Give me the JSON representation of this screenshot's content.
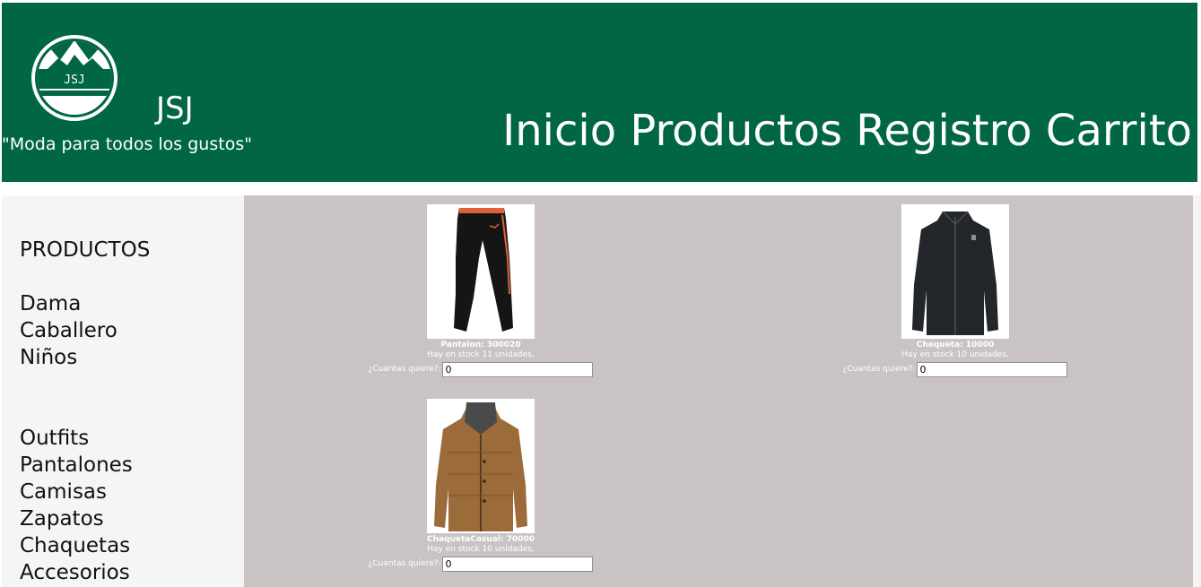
{
  "header": {
    "brand": "JSJ",
    "logo_text": "JSJ",
    "slogan": "\"Moda para todos los gustos\"",
    "nav": [
      "Inicio",
      "Productos",
      "Registro",
      "Carrito"
    ],
    "colors": {
      "header_bg": "#006643",
      "content_bg": "#c9c4c3",
      "sidebar_bg": "#f5f5f5"
    }
  },
  "sidebar": {
    "heading": "PRODUCTOS",
    "categories": [
      "Dama",
      "Caballero",
      "Niños"
    ],
    "types": [
      "Outfits",
      "Pantalones",
      "Camisas",
      "Zapatos",
      "Chaquetas",
      "Accesorios"
    ]
  },
  "products": [
    {
      "title": "Pantalon: 300020",
      "stock": "Hay en stock 11 unidades,",
      "qty_label": "¿Cuantas quiere?:",
      "qty_value": "0",
      "image": "pants-image"
    },
    {
      "title": "Chaqueta: 10000",
      "stock": "Hay en stock 10 unidades,",
      "qty_label": "¿Cuantas quiere?:",
      "qty_value": "0",
      "image": "black-jacket-image"
    },
    {
      "title": "ChaquetaCasual: 70000",
      "stock": "Hay en stock 10 unidades,",
      "qty_label": "¿Cuantas quiere?:",
      "qty_value": "0",
      "image": "brown-jacket-image"
    }
  ]
}
